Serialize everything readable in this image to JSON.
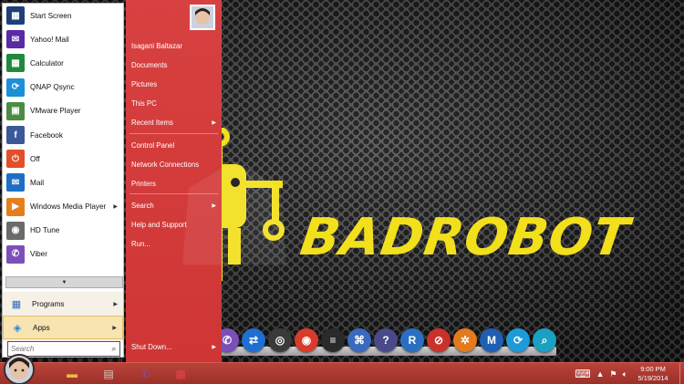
{
  "wallpaper": {
    "text": "BADROBOT",
    "accent": "#f2e01c"
  },
  "start_menu": {
    "pinned": [
      {
        "label": "Start Screen",
        "icon": "start-screen-icon",
        "color": "#1f3f7a",
        "glyph": "▦",
        "arrow": false
      },
      {
        "label": "Yahoo! Mail",
        "icon": "yahoo-mail-icon",
        "color": "#5b2aa6",
        "glyph": "✉",
        "arrow": false
      },
      {
        "label": "Calculator",
        "icon": "calculator-icon",
        "color": "#1f8a3b",
        "glyph": "▦",
        "arrow": false
      },
      {
        "label": "QNAP Qsync",
        "icon": "qnap-qsync-icon",
        "color": "#1d8ed8",
        "glyph": "⟳",
        "arrow": false
      },
      {
        "label": "VMware Player",
        "icon": "vmware-icon",
        "color": "#4b8c45",
        "glyph": "▣",
        "arrow": false
      },
      {
        "label": "Facebook",
        "icon": "facebook-icon",
        "color": "#3b5998",
        "glyph": "f",
        "arrow": false
      },
      {
        "label": "Off",
        "icon": "power-off-icon",
        "color": "#e0502a",
        "glyph": "⏻",
        "arrow": false
      },
      {
        "label": "Mail",
        "icon": "mail-icon",
        "color": "#1e6fc4",
        "glyph": "✉",
        "arrow": false
      },
      {
        "label": "Windows Media Player",
        "icon": "media-player-icon",
        "color": "#e57e1c",
        "glyph": "▶",
        "arrow": true
      },
      {
        "label": "HD Tune",
        "icon": "hd-tune-icon",
        "color": "#6a6a6a",
        "glyph": "◉",
        "arrow": false
      },
      {
        "label": "Viber",
        "icon": "viber-icon",
        "color": "#7c4fb8",
        "glyph": "✆",
        "arrow": false
      }
    ],
    "expand_glyph": "▼",
    "programs": {
      "label": "Programs",
      "icon": "programs-icon"
    },
    "apps": {
      "label": "Apps",
      "icon": "apps-icon"
    },
    "search": {
      "placeholder": "Search"
    },
    "right": {
      "user": "Isagani Baltazar",
      "documents": "Documents",
      "pictures": "Pictures",
      "this_pc": "This PC",
      "recent": "Recent Items",
      "control_panel": "Control Panel",
      "network": "Network Connections",
      "printers": "Printers",
      "search": "Search",
      "help": "Help and Support",
      "run": "Run...",
      "shutdown": "Shut Down..."
    }
  },
  "dock": [
    {
      "icon": "viber-dock-icon",
      "color": "#7c4fb8",
      "glyph": "✆"
    },
    {
      "icon": "teamviewer-icon",
      "color": "#1f6fd1",
      "glyph": "⇄"
    },
    {
      "icon": "steam-icon",
      "color": "#3a3a3a",
      "glyph": "◎"
    },
    {
      "icon": "chrome-icon",
      "color": "#d93b2b",
      "glyph": "◉"
    },
    {
      "icon": "mixer-icon",
      "color": "#2a2a2a",
      "glyph": "≡"
    },
    {
      "icon": "network-icon",
      "color": "#3a6ac0",
      "glyph": "⌘"
    },
    {
      "icon": "help-icon",
      "color": "#4a4a8a",
      "glyph": "?"
    },
    {
      "icon": "rainmeter-icon",
      "color": "#2b6fc2",
      "glyph": "R"
    },
    {
      "icon": "no-entry-icon",
      "color": "#c7332b",
      "glyph": "⊘"
    },
    {
      "icon": "pinwheel-icon",
      "color": "#e27b1d",
      "glyph": "✲"
    },
    {
      "icon": "malwarebytes-icon",
      "color": "#1e5fb4",
      "glyph": "M"
    },
    {
      "icon": "sync-icon",
      "color": "#1d9ad8",
      "glyph": "⟳"
    },
    {
      "icon": "magnifier-icon",
      "color": "#1aa0c0",
      "glyph": "⌕"
    }
  ],
  "taskbar": {
    "buttons": [
      {
        "icon": "file-explorer-icon",
        "glyph": "▬",
        "color": "#e8b84a"
      },
      {
        "icon": "tablet-app-icon",
        "glyph": "▤",
        "color": "#d8d2c0"
      },
      {
        "icon": "viber-taskbar-icon",
        "glyph": "✆",
        "color": "#7c4fb8"
      },
      {
        "icon": "start-screen-taskbar-icon",
        "glyph": "▦",
        "color": "#e04848"
      }
    ],
    "time": "9:00 PM",
    "date": "5/19/2014"
  }
}
